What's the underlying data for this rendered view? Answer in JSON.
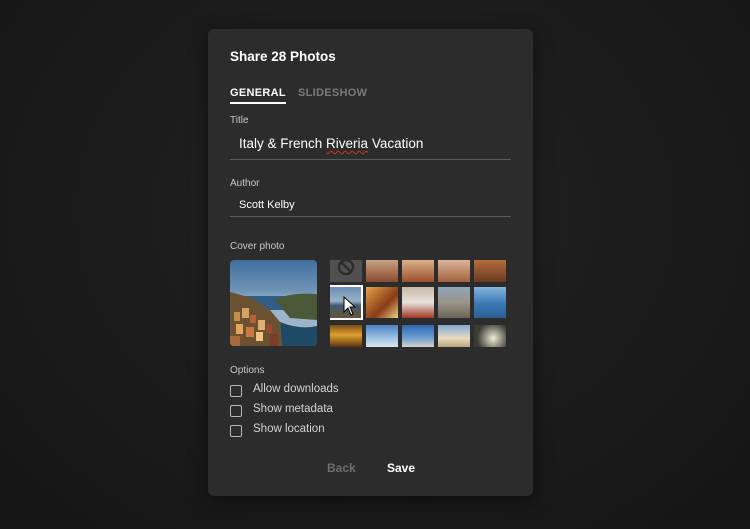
{
  "dialog": {
    "title": "Share 28 Photos",
    "tabs": [
      {
        "label": "GENERAL",
        "active": true
      },
      {
        "label": "SLIDESHOW",
        "active": false
      }
    ],
    "title_label": "Title",
    "title_value": {
      "before": "Italy & French ",
      "misspelled": "Riveria",
      "after": " Vacation"
    },
    "author_label": "Author",
    "author_value": "Scott Kelby",
    "cover_label": "Cover photo",
    "options_label": "Options",
    "options": [
      {
        "label": "Allow downloads",
        "checked": false
      },
      {
        "label": "Show metadata",
        "checked": false
      },
      {
        "label": "Show location",
        "checked": false
      }
    ],
    "back_label": "Back",
    "save_label": "Save"
  },
  "colors": {
    "dialog_bg": "#2c2c2c",
    "page_bg": "#1b1b1b",
    "spell_underline": "#d0302b"
  }
}
